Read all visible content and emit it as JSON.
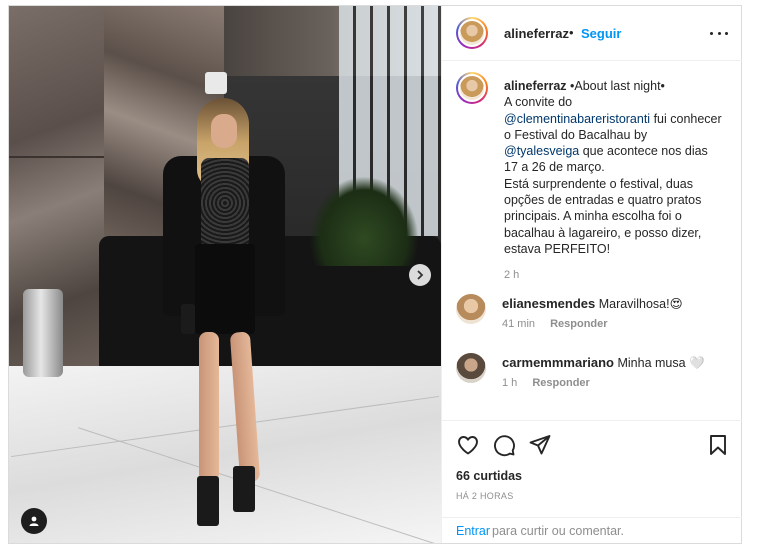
{
  "header": {
    "username": "alineferraz",
    "separator": "•",
    "follow_label": "Seguir"
  },
  "caption": {
    "username": "alineferraz",
    "title": "•About last night•",
    "line1": "A convite do",
    "mention1": "@clementinabareristoranti",
    "line2": " fui conhecer o Festival do Bacalhau by",
    "mention2": "@tyalesveiga",
    "line3": " que acontece nos dias 17 a 26 de março.",
    "line4": "Está surprendente o festival, duas opções de entradas e quatro pratos principais. A minha escolha foi o bacalhau à lagareiro, e posso dizer, estava PERFEITO!",
    "time": "2 h"
  },
  "comments": [
    {
      "username": "elianesmendes",
      "text": "Maravilhosa!😍",
      "time": "41 min",
      "reply": "Responder"
    },
    {
      "username": "carmemmmariano",
      "text": "Minha musa 🤍",
      "time": "1 h",
      "reply": "Responder"
    }
  ],
  "actions": {
    "likes": "66 curtidas",
    "posted": "HÁ 2 HORAS",
    "login_link": "Entrar",
    "login_rest": "para curtir ou comentar."
  },
  "icons": {
    "like": "heart-icon",
    "comment": "comment-icon",
    "share": "share-icon",
    "save": "bookmark-icon",
    "next": "chevron-right-icon",
    "tags": "user-tag-icon",
    "more": "more-options-icon"
  },
  "colors": {
    "accent": "#0095f6",
    "mention": "#00376b",
    "muted": "#8e8e8e",
    "text": "#262626"
  }
}
